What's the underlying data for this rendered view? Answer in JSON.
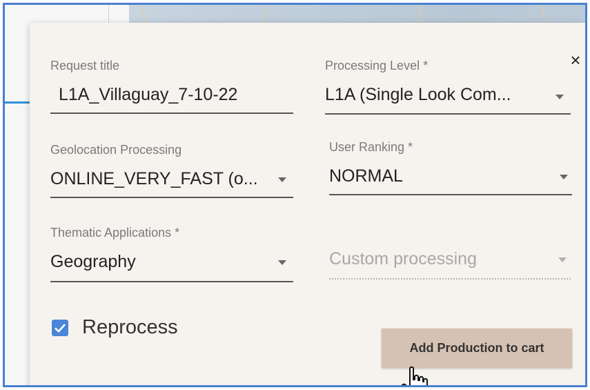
{
  "dialog": {
    "close_glyph": "×",
    "request_title": {
      "label": "Request title",
      "value": "L1A_Villaguay_7-10-22"
    },
    "processing_level": {
      "label": "Processing Level *",
      "value": "L1A (Single Look Com..."
    },
    "geolocation_processing": {
      "label": "Geolocation Processing",
      "value": "ONLINE_VERY_FAST (o..."
    },
    "user_ranking": {
      "label": "User Ranking *",
      "value": "NORMAL"
    },
    "thematic_applications": {
      "label": "Thematic Applications *",
      "value": "Geography"
    },
    "custom_processing": {
      "placeholder": "Custom processing"
    },
    "reprocess": {
      "label": "Reprocess",
      "checked": true
    },
    "add_button_label": "Add Production to cart"
  },
  "colors": {
    "accent": "#4a86d8",
    "button_bg": "#d6c2b2",
    "dialog_bg": "#f6f3ef",
    "frame_border": "#4a7fd0"
  }
}
